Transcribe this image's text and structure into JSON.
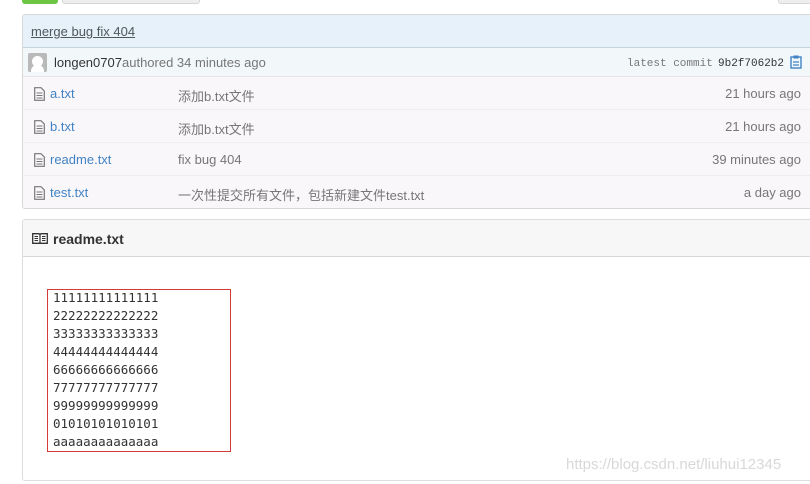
{
  "commit": {
    "message": "merge bug fix 404",
    "author": "longen0707",
    "authored_label": "authored 34 minutes ago",
    "latest_label": "latest commit",
    "sha": "9b2f7062b2"
  },
  "files": [
    {
      "name": "a.txt",
      "message": "添加b.txt文件",
      "age": "21 hours ago",
      "icon": "file-icon"
    },
    {
      "name": "b.txt",
      "message": "添加b.txt文件",
      "age": "21 hours ago",
      "icon": "file-icon"
    },
    {
      "name": "readme.txt",
      "message": "fix bug 404",
      "age": "39 minutes ago",
      "icon": "file-icon"
    },
    {
      "name": "test.txt",
      "message": "一次性提交所有文件，包括新建文件test.txt",
      "age": "a day ago",
      "icon": "file-icon"
    }
  ],
  "readme": {
    "title": "readme.txt",
    "icon": "book-icon",
    "lines": [
      "11111111111111",
      "22222222222222",
      "33333333333333",
      "44444444444444",
      "66666666666666",
      "77777777777777",
      "99999999999999",
      "01010101010101",
      "aaaaaaaaaaaaaa"
    ]
  },
  "watermark": "https://blog.csdn.net/liuhui12345",
  "colors": {
    "link": "#4183c4",
    "commit_bar": "#e7f1fa",
    "highlight_box": "#d33b3b"
  }
}
